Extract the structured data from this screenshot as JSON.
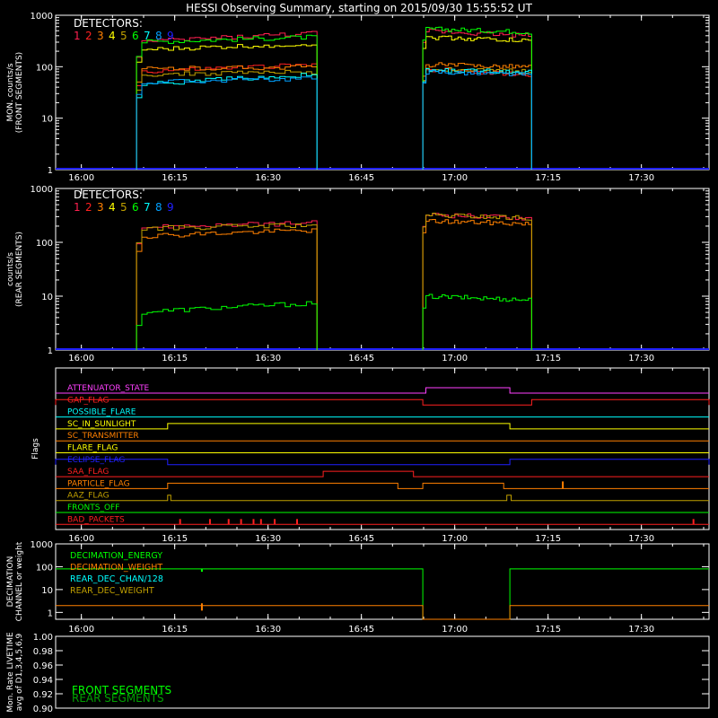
{
  "title": "HESSI Observing Summary, starting on 2015/09/30 15:55:52 UT",
  "colors": {
    "background": "#000000",
    "axis": "#ffffff",
    "det": [
      "#ff2050",
      "#ff2020",
      "#ff8000",
      "#ffff00",
      "#c0a000",
      "#00ff00",
      "#00ffff",
      "#00a0ff",
      "#2020ff"
    ]
  },
  "time_ticks": [
    "16:00",
    "16:15",
    "16:30",
    "16:45",
    "17:00",
    "17:15",
    "17:30"
  ],
  "chart_data": [
    {
      "type": "line",
      "ylabel": [
        "MON. counts/s",
        "(FRONT SEGMENTS)"
      ],
      "yscale": "log",
      "ylim": [
        1,
        1000
      ],
      "y_ticks": [
        "1",
        "10",
        "100",
        "1000"
      ],
      "legend_title": "DETECTORS:",
      "legend_digits": [
        "1",
        "2",
        "3",
        "4",
        "5",
        "6",
        "7",
        "8",
        "9"
      ],
      "x_unit": "minutes since 15:55:52",
      "intervals": [
        [
          13,
          42
        ],
        [
          59,
          76.5
        ]
      ],
      "series": [
        {
          "detector": "1",
          "color": "#ff2050",
          "values": [
            [
              300,
              450
            ],
            [
              500,
              400
            ]
          ]
        },
        {
          "detector": "2",
          "color": "#ff2020",
          "values": [
            [
              80,
              110
            ],
            [
              90,
              70
            ]
          ]
        },
        {
          "detector": "3",
          "color": "#ff8000",
          "values": [
            [
              90,
              100
            ],
            [
              110,
              100
            ]
          ]
        },
        {
          "detector": "4",
          "color": "#ffff00",
          "values": [
            [
              210,
              280
            ],
            [
              380,
              320
            ]
          ]
        },
        {
          "detector": "5",
          "color": "#c0a000",
          "values": [
            [
              70,
              80
            ],
            [
              90,
              80
            ]
          ]
        },
        {
          "detector": "6",
          "color": "#00ff00",
          "values": [
            [
              300,
              380
            ],
            [
              550,
              470
            ]
          ]
        },
        {
          "detector": "7",
          "color": "#00ffff",
          "values": [
            [
              45,
              70
            ],
            [
              85,
              80
            ]
          ]
        },
        {
          "detector": "8",
          "color": "#00a0ff",
          "values": [
            [
              50,
              60
            ],
            [
              80,
              70
            ]
          ]
        }
      ]
    },
    {
      "type": "line",
      "ylabel": [
        "counts/s",
        "(REAR SEGMENTS)"
      ],
      "yscale": "log",
      "ylim": [
        1,
        1000
      ],
      "y_ticks": [
        "1",
        "10",
        "100",
        "1000"
      ],
      "legend_title": "DETECTORS:",
      "legend_digits": [
        "1",
        "2",
        "3",
        "4",
        "5",
        "6",
        "7",
        "8",
        "9"
      ],
      "x_unit": "minutes since 15:55:52",
      "intervals": [
        [
          13,
          42
        ],
        [
          59,
          76.5
        ]
      ],
      "series": [
        {
          "detector": "1",
          "color": "#ff2050",
          "values": [
            [
              190,
              230
            ],
            [
              330,
              280
            ]
          ]
        },
        {
          "detector": "3",
          "color": "#ff8000",
          "values": [
            [
              130,
              170
            ],
            [
              250,
              220
            ]
          ]
        },
        {
          "detector": "5",
          "color": "#c0a000",
          "values": [
            [
              180,
              210
            ],
            [
              320,
              280
            ]
          ]
        },
        {
          "detector": "6",
          "color": "#00ff00",
          "values": [
            [
              5,
              7.5
            ],
            [
              10,
              8.5
            ]
          ]
        }
      ]
    },
    {
      "type": "flags",
      "ylabel": "Flags",
      "x_unit": "minutes since 15:55:52",
      "flags": [
        {
          "name": "ATTENUATOR_STATE",
          "color": "#ff40ff",
          "high": [
            [
              59.5,
              73
            ]
          ]
        },
        {
          "name": "GAP_FLAG",
          "color": "#ff2020",
          "high": [
            [
              0,
              59
            ],
            [
              76.5,
              105
            ]
          ]
        },
        {
          "name": "POSSIBLE_FLARE",
          "color": "#00ffff",
          "high": []
        },
        {
          "name": "SC_IN_SUNLIGHT",
          "color": "#ffff00",
          "high": [
            [
              18,
              73
            ]
          ]
        },
        {
          "name": "SC_TRANSMITTER",
          "color": "#ff8000",
          "high": []
        },
        {
          "name": "FLARE_FLAG",
          "color": "#ffff00",
          "high": []
        },
        {
          "name": "ECLIPSE_FLAG",
          "color": "#2020ff",
          "high": [
            [
              0,
              18
            ],
            [
              73,
              105
            ]
          ]
        },
        {
          "name": "SAA_FLAG",
          "color": "#ff2020",
          "high": [
            [
              43,
              57.5
            ]
          ]
        },
        {
          "name": "PARTICLE_FLAG",
          "color": "#ff8000",
          "high": [
            [
              18,
              55
            ],
            [
              59,
              72
            ]
          ]
        },
        {
          "name": "AAZ_FLAG",
          "color": "#c0a000",
          "high": [
            [
              18,
              18.5
            ],
            [
              72.5,
              73.2
            ]
          ]
        },
        {
          "name": "FRONTS_OFF",
          "color": "#00ff00",
          "high": []
        },
        {
          "name": "BAD_PACKETS",
          "color": "#ff2020",
          "high": []
        }
      ],
      "bad_packet_spikes": [
        20,
        24.8,
        27.8,
        29.8,
        31.8,
        33,
        35.2,
        38.8,
        102.5
      ],
      "particle_spike": 81.5
    },
    {
      "type": "line",
      "ylabel": [
        "DECIMATION",
        "CHANNEL or weight"
      ],
      "yscale": "log",
      "ylim": [
        0.5,
        1000
      ],
      "y_ticks": [
        "1",
        "10",
        "100",
        "1000"
      ],
      "x_unit": "minutes since 15:55:52",
      "series": [
        {
          "name": "DECIMATION_ENERGY",
          "color": "#00ff00",
          "points": [
            [
              0,
              80
            ],
            [
              59,
              80
            ],
            [
              59,
              0.3
            ],
            [
              73,
              0.3
            ],
            [
              73,
              80
            ],
            [
              105,
              80
            ]
          ]
        },
        {
          "name": "DECIMATION_WEIGHT",
          "color": "#ff8000",
          "points": [
            [
              0,
              2
            ],
            [
              59,
              2
            ],
            [
              59,
              0.3
            ],
            [
              73,
              0.3
            ],
            [
              73,
              2
            ],
            [
              105,
              2
            ]
          ]
        },
        {
          "name": "REAR_DEC_CHAN/128",
          "color": "#00ffff",
          "points": []
        },
        {
          "name": "REAR_DEC_WEIGHT",
          "color": "#c0a000",
          "points": []
        }
      ]
    },
    {
      "type": "line",
      "ylabel": [
        "Mon. Rate LIVETIME",
        "avg of D1,3,4,5,6,9"
      ],
      "ylim": [
        0.9,
        1.0
      ],
      "y_ticks": [
        "0.90",
        "0.92",
        "0.94",
        "0.96",
        "0.98",
        "1.00"
      ],
      "series": [
        {
          "name": "FRONT SEGMENTS",
          "color": "#00ff00",
          "values": []
        },
        {
          "name": "REAR SEGMENTS",
          "color": "#00a000",
          "values": []
        }
      ]
    }
  ]
}
